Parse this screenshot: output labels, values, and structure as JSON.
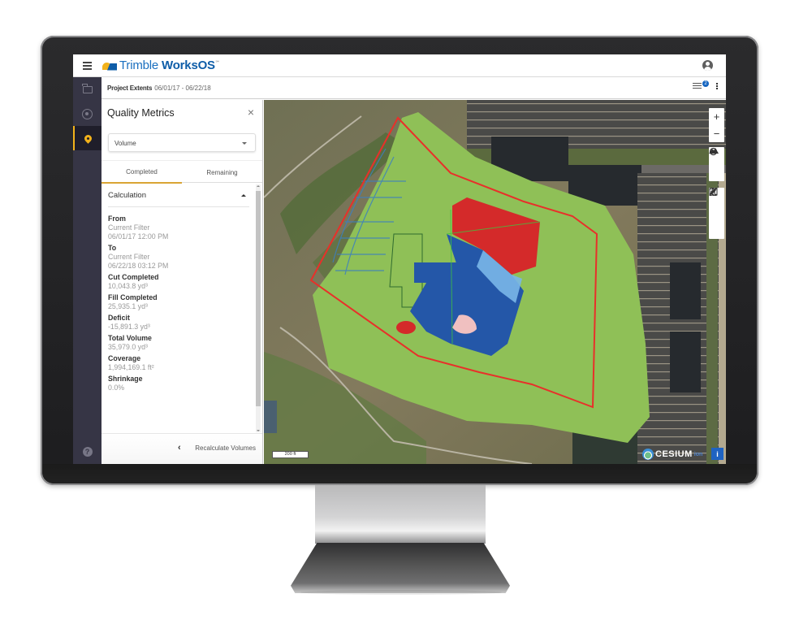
{
  "app": {
    "brand_prefix": "Trimble",
    "brand_name": "WorksOS",
    "brand_mark": "℠"
  },
  "leftnav": {
    "items": [
      {
        "name": "projects",
        "icon": "folder-icon"
      },
      {
        "name": "dashboard",
        "icon": "gauge-icon"
      },
      {
        "name": "map",
        "icon": "map-pin-icon",
        "active": true
      },
      {
        "name": "help",
        "icon": "help-icon",
        "glyph": "?"
      }
    ]
  },
  "subbar": {
    "label": "Project Extents",
    "date_range": "06/01/17 - 06/22/18",
    "filter_badge_count": "2"
  },
  "panel": {
    "title": "Quality Metrics",
    "close_glyph": "×",
    "select_value": "Volume",
    "tabs": [
      {
        "label": "Completed",
        "active": true
      },
      {
        "label": "Remaining",
        "active": false
      }
    ],
    "section_title": "Calculation",
    "metrics": [
      {
        "label": "From",
        "values": [
          "Current Filter",
          "06/01/17 12:00 PM"
        ]
      },
      {
        "label": "To",
        "values": [
          "Current Filter",
          "06/22/18 03:12 PM"
        ]
      },
      {
        "label": "Cut Completed",
        "values": [
          "10,043.8 yd³"
        ]
      },
      {
        "label": "Fill Completed",
        "values": [
          "25,935.1 yd³"
        ]
      },
      {
        "label": "Deficit",
        "values": [
          "-15,891.3 yd³"
        ]
      },
      {
        "label": "Total Volume",
        "values": [
          "35,979.0 yd³"
        ]
      },
      {
        "label": "Coverage",
        "values": [
          "1,994,169.1 ft²"
        ]
      },
      {
        "label": "Shrinkage",
        "values": [
          "0.0%"
        ]
      }
    ],
    "footer_back_glyph": "‹",
    "recalculate_label": "Recalculate Volumes"
  },
  "map": {
    "controls": {
      "zoom_in": "+",
      "zoom_out": "−"
    },
    "scale_label": "200 ft",
    "attribution_name": "CESIUM",
    "attribution_suffix": "ion",
    "info_glyph": "i",
    "colors": {
      "coverage": "#8fc057",
      "boundary": "#e8302a",
      "cut": "#d42a2a",
      "fill": "#2457a8"
    }
  }
}
